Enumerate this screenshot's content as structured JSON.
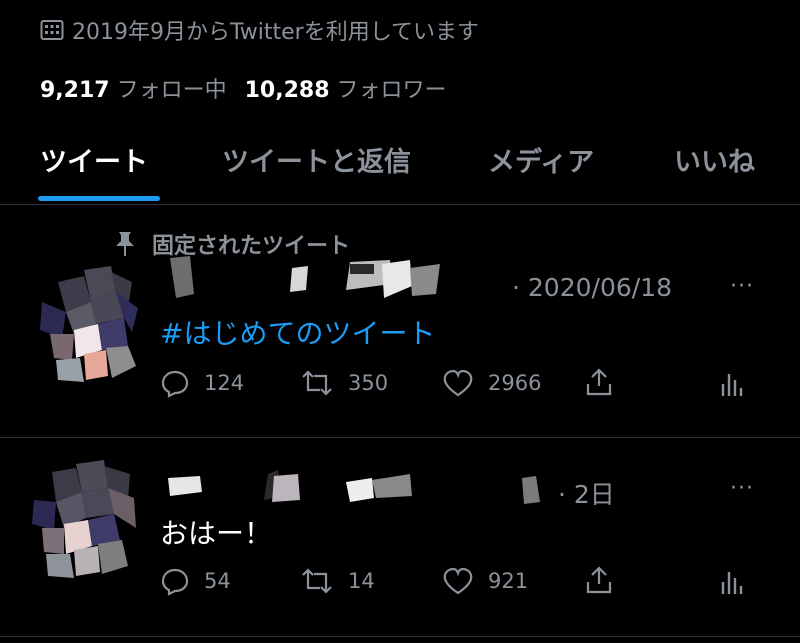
{
  "profile": {
    "joined_text": "2019年9月からTwitterを利用しています",
    "following_count": "9,217",
    "following_label": "フォロー中",
    "followers_count": "10,288",
    "followers_label": "フォロワー"
  },
  "tabs": [
    {
      "label": "ツイート",
      "active": true
    },
    {
      "label": "ツイートと返信",
      "active": false
    },
    {
      "label": "メディア",
      "active": false
    },
    {
      "label": "いいね",
      "active": false
    }
  ],
  "tweets": [
    {
      "pinned_label": "固定されたツイート",
      "time": "· 2020/06/18",
      "text": "#はじめてのツイート",
      "replies": "124",
      "retweets": "350",
      "likes": "2966",
      "more": "···"
    },
    {
      "time": "· 2日",
      "text": "おはー！",
      "replies": "54",
      "retweets": "14",
      "likes": "921",
      "more": "···"
    }
  ],
  "colors": {
    "accent": "#1d9bf0",
    "muted": "#8b9299",
    "background": "#000000"
  }
}
